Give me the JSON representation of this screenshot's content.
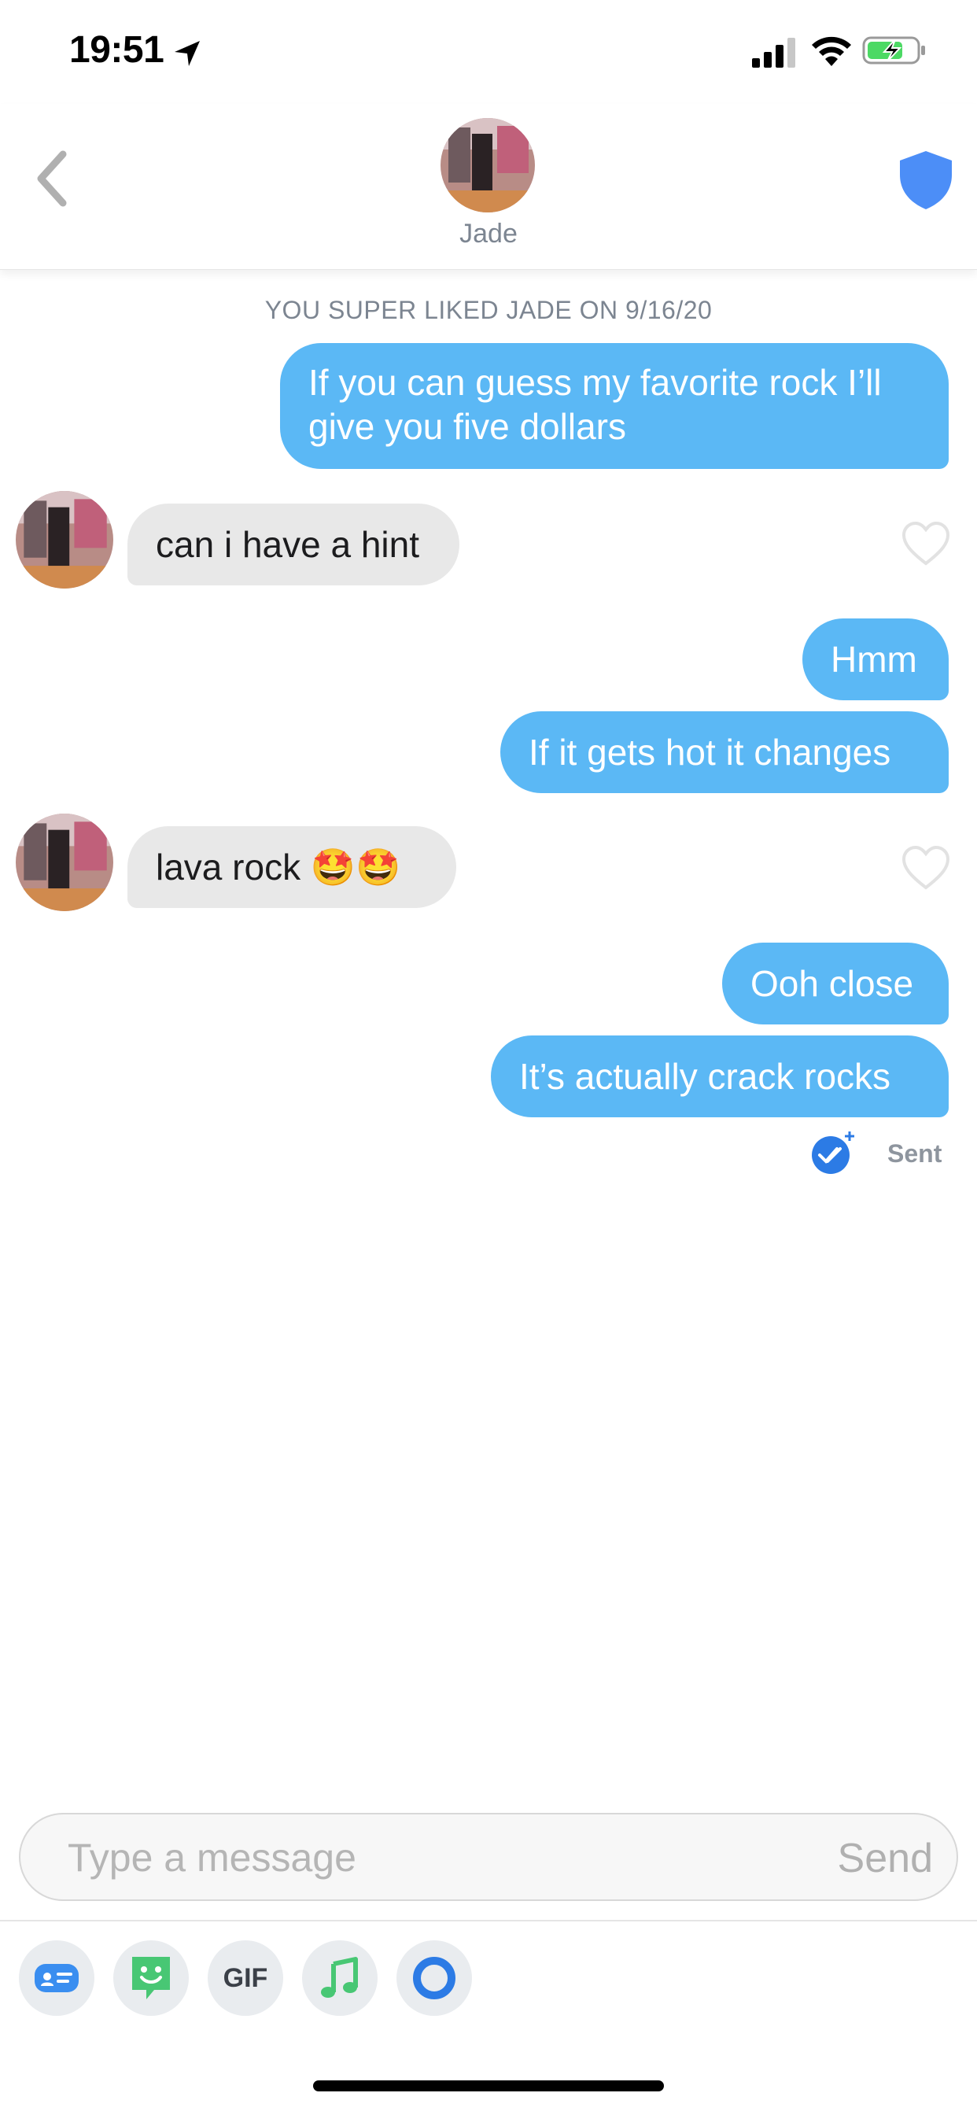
{
  "status_bar": {
    "time": "19:51"
  },
  "header": {
    "name": "Jade"
  },
  "match_label": "YOU SUPER LIKED JADE ON 9/16/20",
  "messages": [
    {
      "from": "me",
      "text": "If you can guess my favorite rock I’ll give you five dollars"
    },
    {
      "from": "jade",
      "text": "can i have a hint"
    },
    {
      "from": "me",
      "text": "Hmm"
    },
    {
      "from": "me",
      "text": "If it gets hot it changes"
    },
    {
      "from": "jade",
      "text": "lava rock 🤩🤩"
    },
    {
      "from": "me",
      "text": "Ooh close"
    },
    {
      "from": "me",
      "text": "It’s actually crack rocks"
    }
  ],
  "read_status": "Sent",
  "composer": {
    "placeholder": "Type a message",
    "send_label": "Send"
  },
  "toolbar": {
    "gif_label": "GIF"
  },
  "colors": {
    "outgoing_bubble": "#5bb8f5",
    "incoming_bubble": "#e8e8e8",
    "shield": "#4c8ef7",
    "accent": "#2c7be5"
  },
  "icons": [
    "location-arrow-icon",
    "signal-icon",
    "wifi-icon",
    "battery-charging-icon",
    "back-chevron-icon",
    "shield-icon",
    "heart-icon",
    "read-receipt-icon",
    "contact-card-icon",
    "sticker-icon",
    "music-note-icon",
    "loop-icon"
  ]
}
